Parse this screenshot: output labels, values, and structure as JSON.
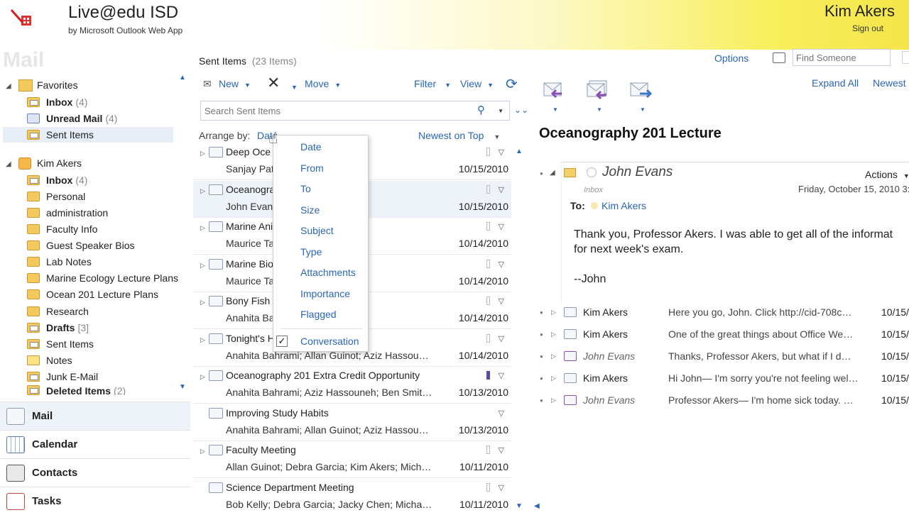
{
  "header": {
    "title": "Live@edu ISD",
    "subtitle": "by Microsoft Outlook Web App",
    "user": "Kim Akers",
    "sign_out": "Sign out"
  },
  "nav": {
    "watermark": "Mail",
    "favorites_label": "Favorites",
    "favorites": [
      {
        "label": "Inbox",
        "count": "(4)"
      },
      {
        "label": "Unread Mail",
        "count": "(4)"
      },
      {
        "label": "Sent Items",
        "count": ""
      }
    ],
    "mailbox_label": "Kim Akers",
    "folders": [
      {
        "label": "Inbox",
        "count": "(4)"
      },
      {
        "label": "Personal",
        "count": ""
      },
      {
        "label": "administration",
        "count": ""
      },
      {
        "label": "Faculty Info",
        "count": ""
      },
      {
        "label": "Guest Speaker Bios",
        "count": ""
      },
      {
        "label": "Lab Notes",
        "count": ""
      },
      {
        "label": "Marine Ecology Lecture Plans",
        "count": ""
      },
      {
        "label": "Ocean 201 Lecture Plans",
        "count": ""
      },
      {
        "label": "Research",
        "count": ""
      },
      {
        "label": "Drafts",
        "count": "[3]"
      },
      {
        "label": "Sent Items",
        "count": ""
      },
      {
        "label": "Notes",
        "count": ""
      },
      {
        "label": "Junk E-Mail",
        "count": ""
      },
      {
        "label": "Deleted Items",
        "count": "(2)"
      }
    ],
    "modules": [
      "Mail",
      "Calendar",
      "Contacts",
      "Tasks"
    ]
  },
  "list": {
    "title": "Sent Items",
    "item_count": "(23 Items)",
    "toolbar": {
      "new": "New",
      "move": "Move",
      "filter": "Filter",
      "view": "View"
    },
    "search_placeholder": "Search Sent Items",
    "arrange_label": "Arrange by:",
    "arrange_value": "Date",
    "sort_order": "Newest on Top",
    "messages": [
      {
        "subject": "Deep Oce",
        "to": "Sanjay Pat",
        "date": "10/15/2010"
      },
      {
        "subject": "Oceanogra",
        "to": "John Evan",
        "date": "10/15/2010"
      },
      {
        "subject": "Marine Ani",
        "to": "Maurice Ta",
        "date": "10/14/2010"
      },
      {
        "subject": "Marine Bio",
        "to": "Maurice Ta",
        "date": "10/14/2010"
      },
      {
        "subject": "Bony Fish",
        "to": "Anahita Ba…n; Ben Smit…",
        "date": "10/14/2010"
      },
      {
        "subject": "Tonight's H",
        "to": "Anahita Bahrami; Allan Guinot; Aziz Hassou…",
        "date": "10/14/2010"
      },
      {
        "subject": "Oceanography 201 Extra Credit Opportunity",
        "to": "Anahita Bahrami; Aziz Hassouneh; Ben Smit…",
        "date": "10/13/2010"
      },
      {
        "subject": "Improving Study Habits",
        "to": "Anahita Bahrami; Allan Guinot; Aziz Hassou…",
        "date": "10/13/2010"
      },
      {
        "subject": "Faculty Meeting",
        "to": "Allan Guinot; Debra Garcia; Kim Akers; Mich…",
        "date": "10/11/2010"
      },
      {
        "subject": "Science Department Meeting",
        "to": "Bob Kelly; Debra Garcia; Jacky Chen; Micha…",
        "date": "10/11/2010"
      }
    ]
  },
  "arrange_menu": {
    "items": [
      "Date",
      "From",
      "To",
      "Size",
      "Subject",
      "Type",
      "Attachments",
      "Importance",
      "Flagged",
      "Conversation"
    ],
    "checked": "Conversation"
  },
  "reading": {
    "options": "Options",
    "find_placeholder": "Find Someone",
    "expand_all": "Expand All",
    "newest": "Newest",
    "title": "Oceanography 201 Lecture",
    "sender": "John Evans",
    "actions": "Actions",
    "folder": "Inbox",
    "sent_date": "Friday, October 15, 2010 3:",
    "to_label": "To:",
    "to_value": "Kim Akers",
    "body": [
      "Thank you, Professor Akers. I was able to get all of the informat",
      "for next week's exam.",
      "--John"
    ],
    "conversation": [
      {
        "from": "Kim Akers",
        "preview": "Here you go, John. Click http://cid-708c…",
        "date": "10/15/",
        "italic": false
      },
      {
        "from": "Kim Akers",
        "preview": "One of the great things about Office We…",
        "date": "10/15/",
        "italic": false
      },
      {
        "from": "John Evans",
        "preview": "Thanks, Professor Akers, but what if I d…",
        "date": "10/15/",
        "italic": true
      },
      {
        "from": "Kim Akers",
        "preview": "Hi John— I'm sorry you're not feeling wel…",
        "date": "10/15/",
        "italic": false
      },
      {
        "from": "John Evans",
        "preview": "Professor Akers— I'm home sick today. …",
        "date": "10/15/",
        "italic": true
      }
    ]
  },
  "colors": {
    "link": "#2a66b8",
    "header_accent": "#f4e54a"
  }
}
